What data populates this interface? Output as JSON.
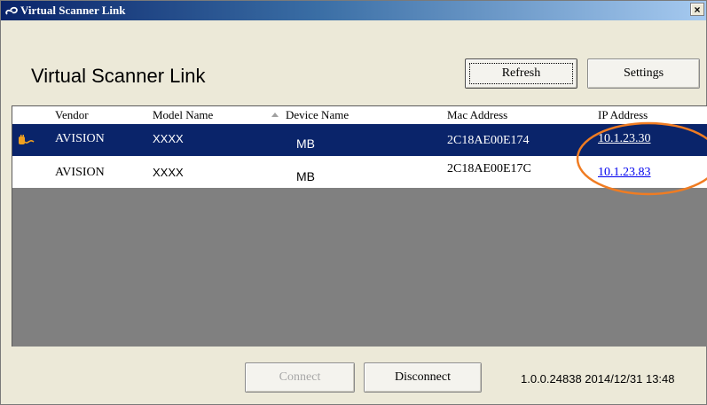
{
  "window": {
    "title": "Virtual Scanner Link",
    "close_label": "×"
  },
  "app_title": "Virtual Scanner Link",
  "toolbar": {
    "refresh_label": "Refresh",
    "settings_label": "Settings"
  },
  "table": {
    "columns": [
      "Vendor",
      "Model Name",
      "Device Name",
      "Mac Address",
      "IP Address"
    ],
    "sort_column": "Device Name",
    "rows": [
      {
        "vendor": "AVISION",
        "model": "XXXX",
        "device": "MB",
        "mac": "2C18AE00E174",
        "ip": "10.1.23.30",
        "selected": true,
        "connected_icon": "plug-icon"
      },
      {
        "vendor": "AVISION",
        "model": "XXXX",
        "device": "MB",
        "mac": "2C18AE00E17C",
        "ip": "10.1.23.83",
        "selected": false,
        "connected_icon": ""
      }
    ]
  },
  "footer": {
    "connect_label": "Connect",
    "disconnect_label": "Disconnect",
    "version_text": "1.0.0.24838  2014/12/31 13:48"
  },
  "colors": {
    "selection": "#0a246a",
    "annotation": "#f07c22",
    "link": "#0000ee"
  }
}
